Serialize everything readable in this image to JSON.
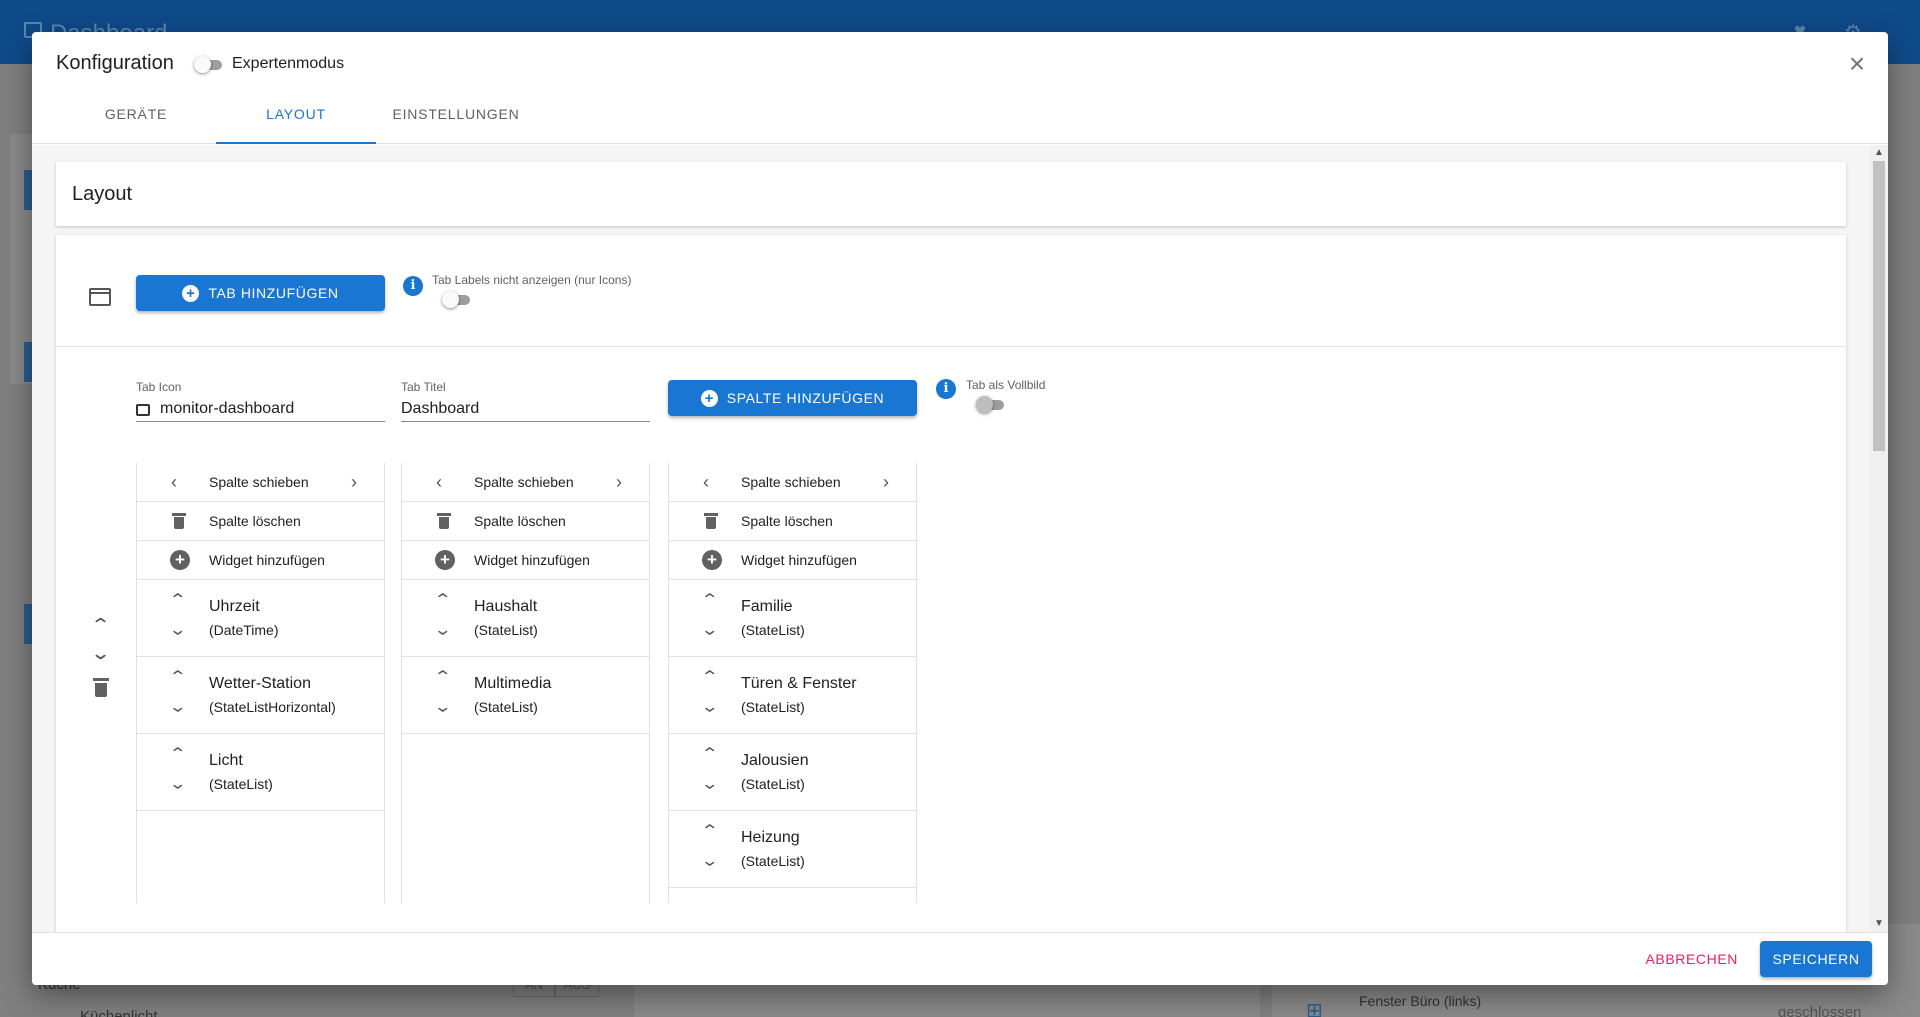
{
  "background": {
    "app_title": "Dashboard",
    "kitchen_label": "Küche",
    "kitchen_sub": "Küchenlicht",
    "seg_on": "AN",
    "seg_off": "AUS",
    "window_label": "Fenster Büro (links)",
    "window_status": "geschlossen"
  },
  "dialog": {
    "title": "Konfiguration",
    "expert_mode_label": "Expertenmodus",
    "expert_mode_on": false,
    "close_icon": "close-icon",
    "tabs": [
      {
        "label": "GERÄTE",
        "active": false
      },
      {
        "label": "LAYOUT",
        "active": true
      },
      {
        "label": "EINSTELLUNGEN",
        "active": false
      }
    ],
    "section_title": "Layout",
    "add_tab_button": "TAB HINZUFÜGEN",
    "hide_tab_labels_label": "Tab Labels nicht anzeigen (nur Icons)",
    "hide_tab_labels_on": false,
    "tab_icon_label": "Tab Icon",
    "tab_icon_value": "monitor-dashboard",
    "tab_title_label": "Tab Titel",
    "tab_title_value": "Dashboard",
    "add_column_button": "SPALTE HINZUFÜGEN",
    "fullscreen_label": "Tab als Vollbild",
    "fullscreen_on": false,
    "column_actions": {
      "move": "Spalte schieben",
      "delete": "Spalte löschen",
      "add_widget": "Widget hinzufügen"
    },
    "columns": [
      {
        "widgets": [
          {
            "name": "Uhrzeit",
            "type": "(DateTime)"
          },
          {
            "name": "Wetter-Station",
            "type": "(StateListHorizontal)"
          },
          {
            "name": "Licht",
            "type": "(StateList)"
          }
        ]
      },
      {
        "widgets": [
          {
            "name": "Haushalt",
            "type": "(StateList)"
          },
          {
            "name": "Multimedia",
            "type": "(StateList)"
          }
        ]
      },
      {
        "widgets": [
          {
            "name": "Familie",
            "type": "(StateList)"
          },
          {
            "name": "Türen & Fenster",
            "type": "(StateList)"
          },
          {
            "name": "Jalousien",
            "type": "(StateList)"
          },
          {
            "name": "Heizung",
            "type": "(StateList)"
          }
        ]
      }
    ],
    "cancel_button": "ABBRECHEN",
    "save_button": "SPEICHERN",
    "colors": {
      "primary": "#1976d2",
      "cancel": "#e91e63",
      "appbar": "#0f4a8a"
    }
  }
}
